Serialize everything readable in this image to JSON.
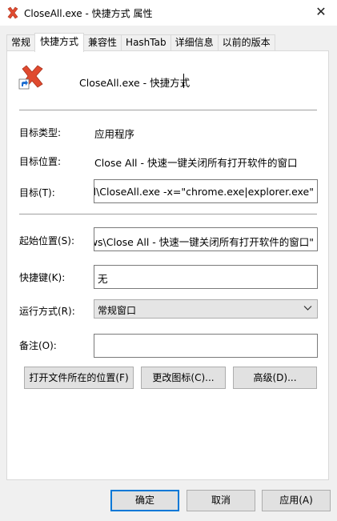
{
  "window": {
    "title": "CloseAll.exe - 快捷方式 属性",
    "close_glyph": "✕"
  },
  "tabs": [
    {
      "label": "常规",
      "active": false
    },
    {
      "label": "快捷方式",
      "active": true
    },
    {
      "label": "兼容性",
      "active": false
    },
    {
      "label": "HashTab",
      "active": false
    },
    {
      "label": "详细信息",
      "active": false
    },
    {
      "label": "以前的版本",
      "active": false
    }
  ],
  "header": {
    "name": "CloseAll.exe - 快捷方式"
  },
  "props": {
    "type_label": "目标类型:",
    "type_value": "应用程序",
    "location_label": "目标位置:",
    "location_value": "Close All - 快速一键关闭所有打开软件的窗口",
    "target_label": "目标(T):",
    "target_value": "eAll\\CloseAll.exe -x=\"chrome.exe|explorer.exe\"",
    "startin_label": "起始位置(S):",
    "startin_value": "ows\\Close All - 快速一键关闭所有打开软件的窗口\"",
    "hotkey_label": "快捷键(K):",
    "hotkey_value": "无",
    "run_label": "运行方式(R):",
    "run_value": "常规窗口",
    "comment_label": "备注(O):",
    "comment_value": ""
  },
  "actions": {
    "open_location": "打开文件所在的位置(F)",
    "change_icon": "更改图标(C)...",
    "advanced": "高级(D)..."
  },
  "footer": {
    "ok": "确定",
    "cancel": "取消",
    "apply": "应用(A)"
  },
  "colors": {
    "icon_red": "#e04a2f",
    "accent": "#0078d7"
  }
}
